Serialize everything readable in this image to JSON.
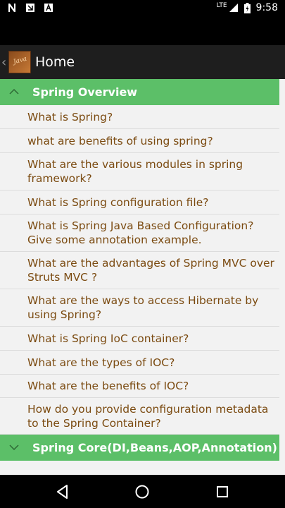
{
  "status_bar": {
    "time": "9:58",
    "network": "LTE",
    "left_icons": [
      "notification-n-icon",
      "download-icon",
      "app-a-icon"
    ]
  },
  "app_bar": {
    "title": "Home",
    "logo_icon": "app-logo-icon"
  },
  "groups": [
    {
      "title": "Spring Overview",
      "expanded": true,
      "items": [
        "What is Spring?",
        "what are benefits of using spring?",
        "What are the various modules in spring framework?",
        "What is Spring configuration file?",
        "What is Spring Java Based Configuration? Give some annotation example.",
        "What are the advantages of Spring MVC over Struts MVC ?",
        "What are the ways to access Hibernate by using Spring?",
        "What is Spring IoC container?",
        "What are the types of IOC?",
        "What are the benefits of IOC?",
        "How do you provide configuration metadata to the Spring Container?"
      ]
    },
    {
      "title": "Spring Core(DI,Beans,AOP,Annotation)",
      "expanded": false,
      "items": []
    }
  ],
  "colors": {
    "header_green": "#5cbf68",
    "item_text": "#7b4b11",
    "list_bg": "#f2f2f2"
  }
}
